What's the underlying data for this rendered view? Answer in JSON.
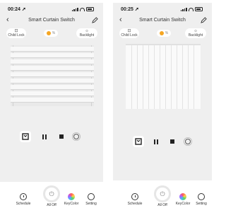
{
  "screens": [
    {
      "status": {
        "time": "00:24 ➚"
      },
      "header": {
        "back": "‹",
        "title": "Smart Curtain Switch"
      },
      "quick": {
        "child_lock": "Child Lock",
        "backlight": "Backlight",
        "mode_text": "%"
      },
      "curtain": {
        "state": "closed",
        "slat_count": 9
      },
      "tabs": {
        "schedule": "Schedule",
        "all_off": "All Off",
        "keycolor": "KeyColor",
        "setting": "Setting"
      }
    },
    {
      "status": {
        "time": "00:25 ➚"
      },
      "header": {
        "back": "‹",
        "title": "Smart Curtain Switch"
      },
      "quick": {
        "child_lock": "Child Lock",
        "backlight": "Backlight",
        "mode_text": "%"
      },
      "curtain": {
        "state": "open"
      },
      "tabs": {
        "schedule": "Schedule",
        "all_off": "All Off",
        "keycolor": "KeyColor",
        "setting": "Setting"
      }
    }
  ],
  "icons": {
    "back": "chevron-left-icon",
    "edit": "pencil-icon",
    "child_lock": "lock-icon",
    "backlight": "light-icon",
    "open": "curtain-open-icon",
    "pause": "pause-icon",
    "stop": "stop-icon",
    "settings": "gear-icon",
    "power": "power-icon",
    "schedule": "clock-icon",
    "keycolor": "color-wheel-icon"
  },
  "colors": {
    "accent": "#f5a623",
    "background": "#efefef",
    "tabbar": "#ffffff"
  }
}
